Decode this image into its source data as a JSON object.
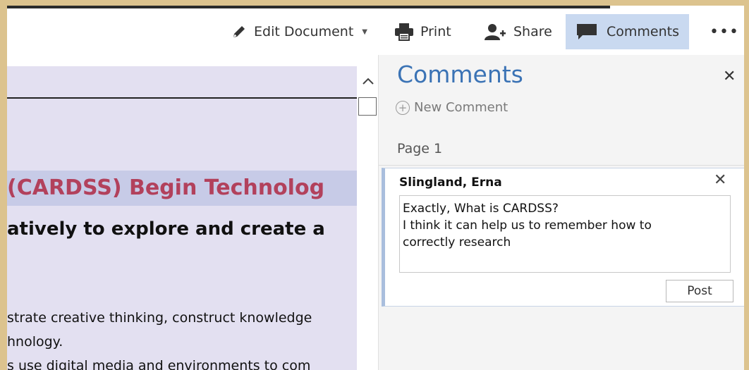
{
  "toolbar": {
    "edit_label": "Edit Document",
    "print_label": "Print",
    "share_label": "Share",
    "comments_label": "Comments",
    "more_label": "•••",
    "active_color": "#c9d9f0"
  },
  "document": {
    "title_fragment": " (CARDSS) Begin Technolog",
    "subtitle_fragment": "atively to explore and create a",
    "lines": [
      "strate creative thinking, construct knowledge",
      "hnology.",
      "s use digital media and environments to com"
    ],
    "title_color": "#b2415c"
  },
  "comments_panel": {
    "title": "Comments",
    "close_symbol": "✕",
    "new_comment_label": "New Comment",
    "page_label": "Page 1",
    "comment": {
      "author": "Slingland, Erna",
      "text": "Exactly, What is CARDSS?\nI think it can help us to remember how to\ncorrectly research",
      "post_label": "Post",
      "close_symbol": "✕"
    }
  }
}
